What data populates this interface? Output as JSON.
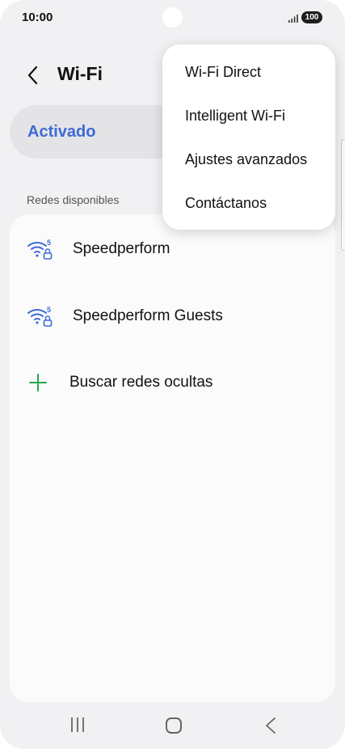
{
  "status_bar": {
    "time": "10:00",
    "battery": "100"
  },
  "header": {
    "title": "Wi-Fi"
  },
  "wifi_toggle": {
    "label": "Activado",
    "state": "on"
  },
  "networks": {
    "section_label": "Redes disponibles",
    "items": [
      {
        "name": "Speedperform",
        "band": "5"
      },
      {
        "name": "Speedperform Guests",
        "band": "5"
      }
    ],
    "add_hidden_label": "Buscar redes ocultas"
  },
  "menu": {
    "items": [
      {
        "label": "Wi-Fi Direct"
      },
      {
        "label": "Intelligent Wi-Fi"
      },
      {
        "label": "Ajustes avanzados"
      },
      {
        "label": "Contáctanos"
      }
    ]
  },
  "colors": {
    "accent": "#3e6ad6",
    "plus_icon": "#1fa84a",
    "background": "#f1f1f3"
  },
  "icons": {
    "back": "chevron-left-icon",
    "wifi_secure": "wifi-lock-icon",
    "add": "plus-icon",
    "nav_recents": "recents-icon",
    "nav_home": "home-icon",
    "nav_back": "back-icon"
  }
}
